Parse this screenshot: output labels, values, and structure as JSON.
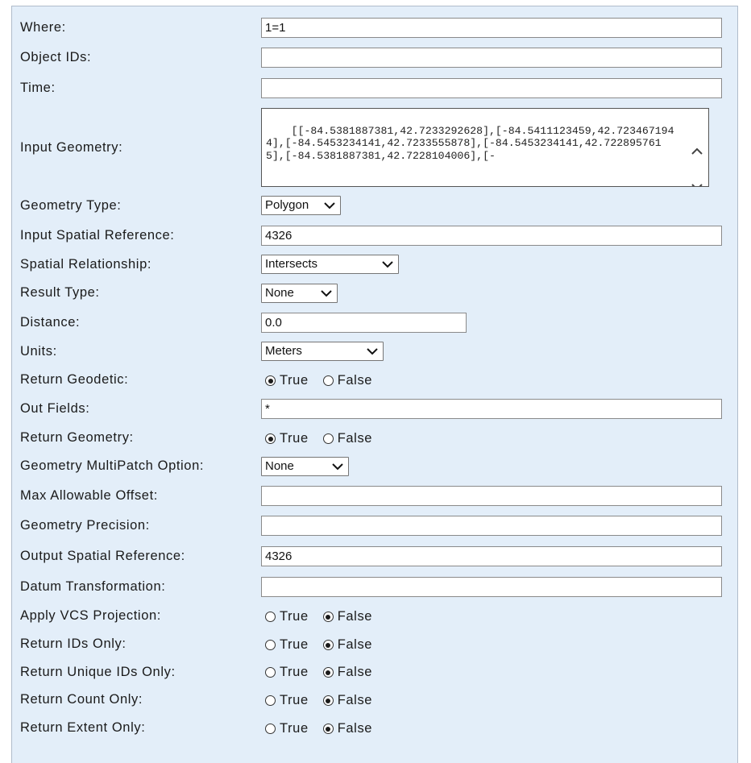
{
  "form": {
    "where": {
      "label": "Where:",
      "value": "1=1"
    },
    "object_ids": {
      "label": "Object IDs:",
      "value": ""
    },
    "time": {
      "label": "Time:",
      "value": ""
    },
    "input_geometry": {
      "label": "Input Geometry:",
      "value": "[[-84.5381887381,42.7233292628],[-84.5411123459,42.7234671944],[-84.5453234141,42.7233555878],[-84.5453234141,42.7228957615],[-84.5381887381,42.7228104006],[-"
    },
    "geometry_type": {
      "label": "Geometry Type:",
      "value": "Polygon"
    },
    "input_spatial_reference": {
      "label": "Input Spatial Reference:",
      "value": "4326"
    },
    "spatial_relationship": {
      "label": "Spatial Relationship:",
      "value": "Intersects"
    },
    "result_type": {
      "label": "Result Type:",
      "value": "None"
    },
    "distance": {
      "label": "Distance:",
      "value": "0.0"
    },
    "units": {
      "label": "Units:",
      "value": "Meters"
    },
    "return_geodetic": {
      "label": "Return Geodetic:",
      "selected": "True"
    },
    "out_fields": {
      "label": "Out Fields:",
      "value": "*"
    },
    "return_geometry": {
      "label": "Return Geometry:",
      "selected": "True"
    },
    "multipatch_option": {
      "label": "Geometry MultiPatch Option:",
      "value": "None"
    },
    "max_allowable_offset": {
      "label": "Max Allowable Offset:",
      "value": ""
    },
    "geometry_precision": {
      "label": "Geometry Precision:",
      "value": ""
    },
    "output_spatial_reference": {
      "label": "Output Spatial Reference:",
      "value": "4326"
    },
    "datum_transformation": {
      "label": "Datum Transformation:",
      "value": ""
    },
    "apply_vcs_projection": {
      "label": "Apply VCS Projection:",
      "selected": "False"
    },
    "return_ids_only": {
      "label": "Return IDs Only:",
      "selected": "False"
    },
    "return_unique_ids_only": {
      "label": "Return Unique IDs Only:",
      "selected": "False"
    },
    "return_count_only": {
      "label": "Return Count Only:",
      "selected": "False"
    },
    "return_extent_only": {
      "label": "Return Extent Only:",
      "selected": "False"
    }
  },
  "radio_labels": {
    "true": "True",
    "false": "False"
  },
  "icons": {
    "select_arrow": "chevron-down-icon",
    "scroll_up": "scroll-up-icon",
    "scroll_down": "scroll-down-icon"
  },
  "colors": {
    "panel_background": "#e3eef9",
    "panel_border": "#b0bccb"
  }
}
